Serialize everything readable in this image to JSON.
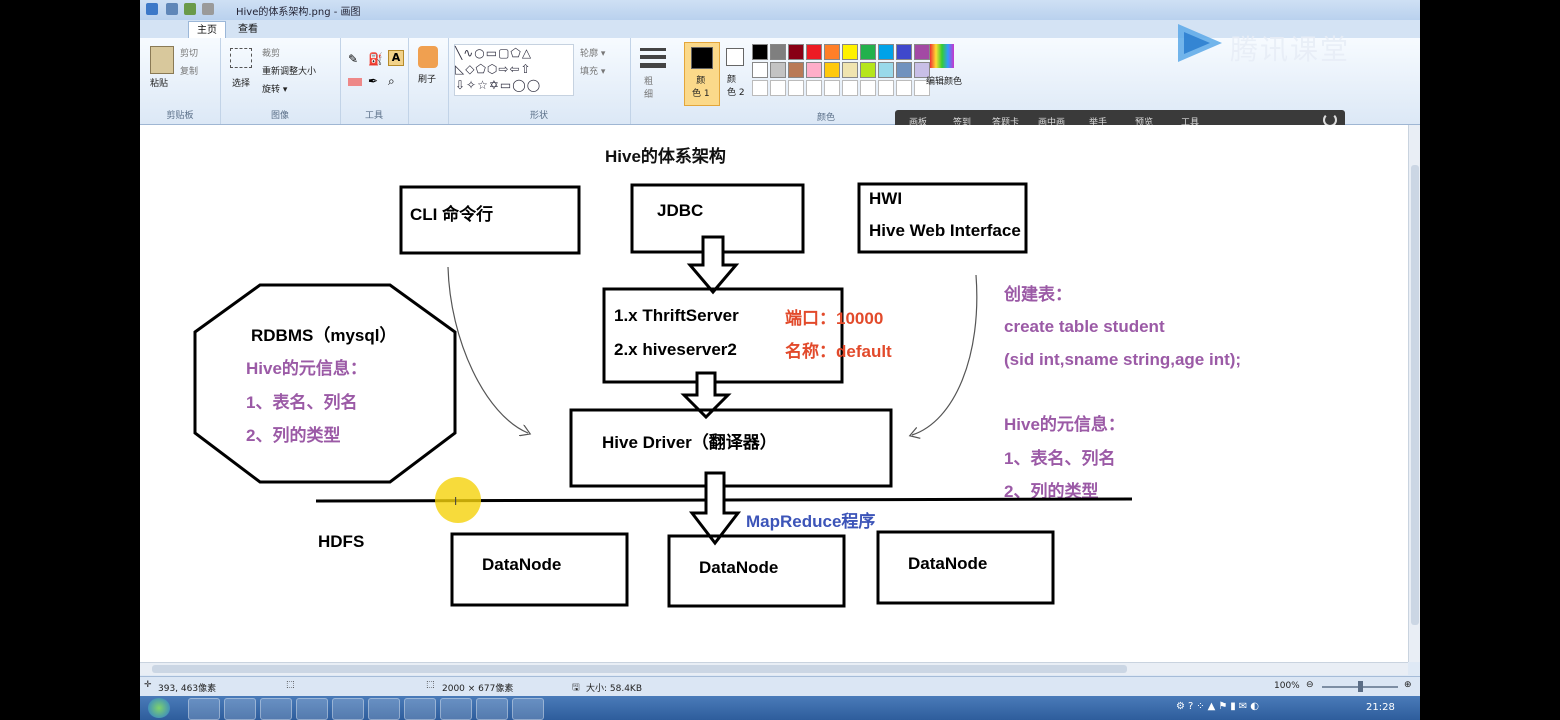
{
  "window": {
    "title": "Hive的体系架构.png - 画图"
  },
  "tabs": {
    "file": "▤ ▾",
    "home": "主页",
    "view": "查看"
  },
  "ribbon": {
    "clipboard": {
      "paste": "粘贴",
      "cut": "剪切",
      "copy": "复制",
      "label": "剪贴板"
    },
    "image": {
      "select": "选择",
      "crop": "裁剪",
      "resize": "重新调整大小",
      "rotate": "旋转 ▾",
      "label": "图像"
    },
    "tools": {
      "label": "工具"
    },
    "brushes": {
      "label": "刷子"
    },
    "shapes": {
      "outline": "轮廓 ▾",
      "fill": "填充 ▾",
      "label": "形状"
    },
    "size": {
      "label": "粗\n细"
    },
    "color1": "颜\n色 1",
    "color2": "颜\n色 2",
    "edit_colors": "编辑颜色",
    "colors_label": "颜色",
    "palette_row1": [
      "#000000",
      "#7f7f7f",
      "#880015",
      "#ed1c24",
      "#ff7f27",
      "#fff200",
      "#22b14c",
      "#00a2e8",
      "#3f48cc",
      "#a349a4"
    ],
    "palette_row2": [
      "#ffffff",
      "#c3c3c3",
      "#b97a57",
      "#ffaec9",
      "#ffc90e",
      "#efe4b0",
      "#b5e61d",
      "#99d9ea",
      "#7092be",
      "#c8bfe7"
    ]
  },
  "tencent_bar": {
    "items": [
      "画板",
      "签到",
      "答题卡",
      "画中画",
      "举手",
      "预览",
      "工具"
    ]
  },
  "logo": {
    "text": "腾讯课堂"
  },
  "diagram": {
    "title": "Hive的体系架构",
    "cli": "CLI 命令行",
    "jdbc": "JDBC",
    "hwi_line1": "HWI",
    "hwi_line2": "Hive Web Interface",
    "rdbms_title": "RDBMS（mysql）",
    "rdbms_meta": "Hive的元信息：",
    "rdbms_item1": "1、表名、列名",
    "rdbms_item2": "2、列的类型",
    "thrift_line1": "1.x  ThriftServer",
    "thrift_line2": "2.x   hiveserver2",
    "port": "端口：10000",
    "name": "名称：default",
    "driver": "Hive Driver（翻译器）",
    "create_label": "创建表：",
    "create_sql1": "create table student",
    "create_sql2": "(sid int,sname string,age int);",
    "meta_label": "Hive的元信息：",
    "meta_item1": "1、表名、列名",
    "meta_item2": "2、列的类型",
    "hdfs": "HDFS",
    "mapreduce": "MapReduce程序",
    "datanode1": "DataNode",
    "datanode2": "DataNode",
    "datanode3": "DataNode"
  },
  "status": {
    "cursor": "393, 463像素",
    "dimensions": "2000 × 677像素",
    "size": "大小: 58.4KB",
    "zoom": "100%"
  },
  "taskbar": {
    "clock": "21:28"
  }
}
